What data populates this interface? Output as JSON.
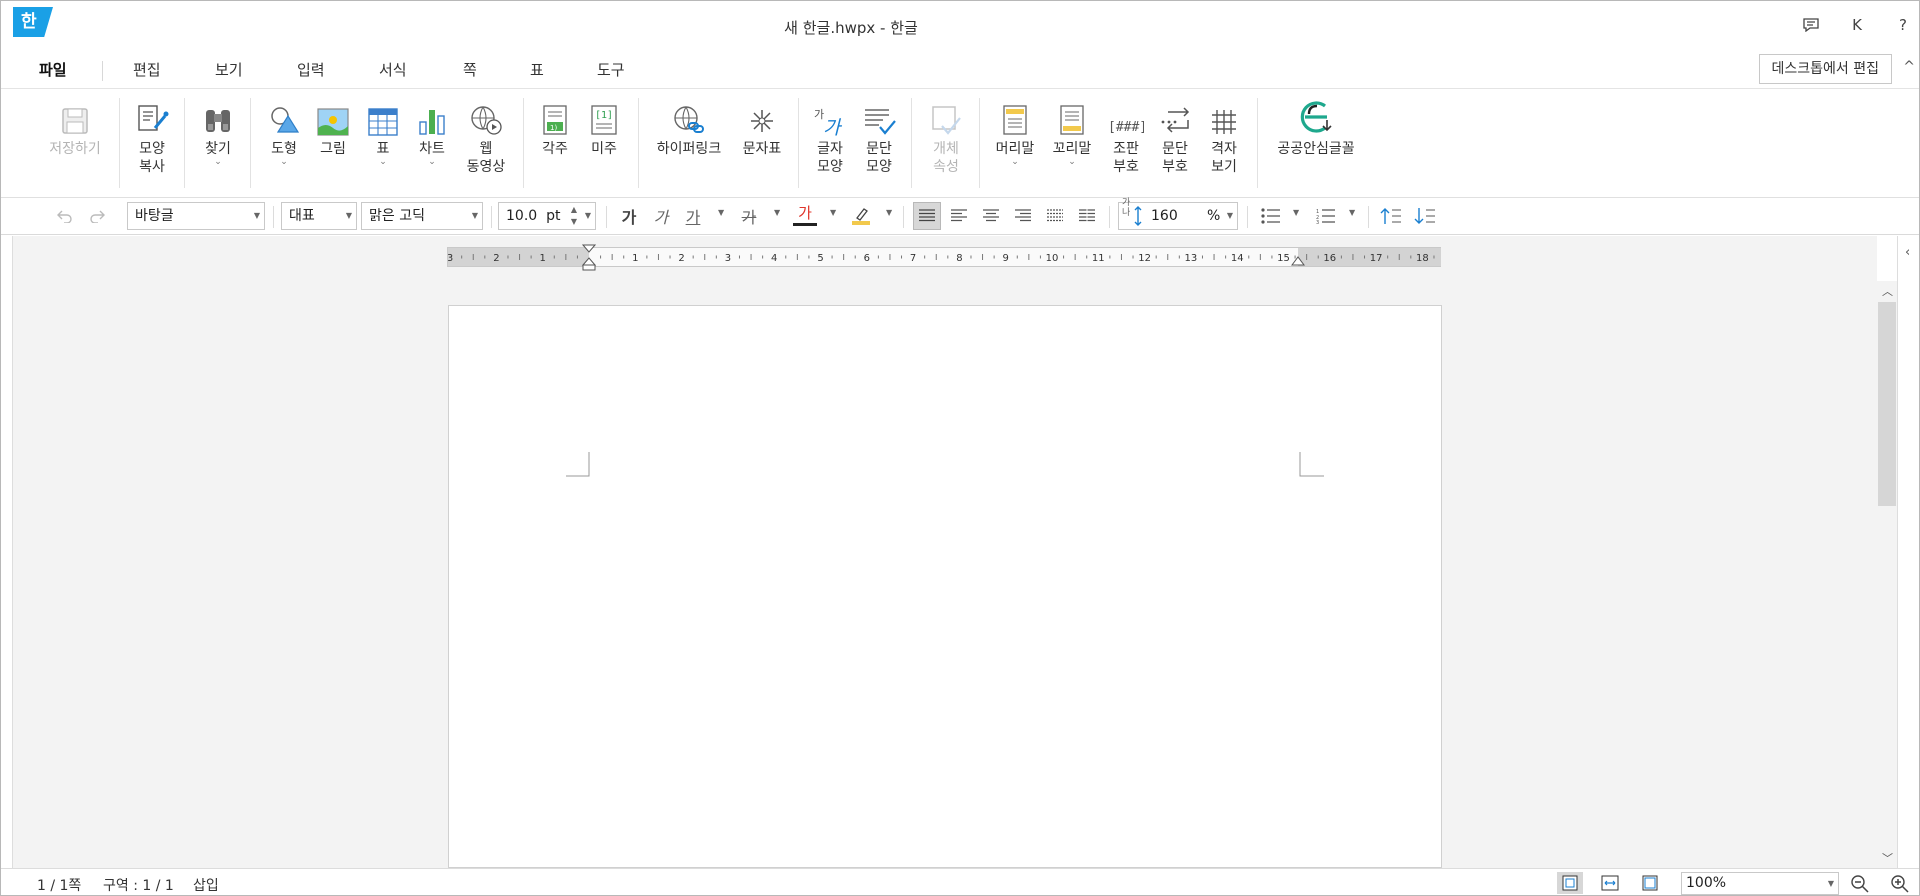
{
  "titlebar": {
    "logo_glyph": "한",
    "title": "새 한글.hwpx - 한글",
    "user_initial": "K",
    "help": "?"
  },
  "menu": {
    "tabs": [
      "파일",
      "편집",
      "보기",
      "입력",
      "서식",
      "쪽",
      "표",
      "도구"
    ],
    "active": "파일",
    "desktop_edit": "데스크톱에서 편집",
    "collapse": "^"
  },
  "ribbon": {
    "save": "저장하기",
    "format_copy": "모양\n복사",
    "find": "찾기",
    "shape": "도형",
    "picture": "그림",
    "table": "표",
    "chart": "차트",
    "web_video": "웹\n동영상",
    "footnote": "각주",
    "endnote": "미주",
    "hyperlink": "하이퍼링크",
    "char_map": "문자표",
    "char_shape": "글자\n모양",
    "para_shape": "문단\n모양",
    "object_props": "개체\n속성",
    "header": "머리말",
    "footer": "꼬리말",
    "layout_mark": "조판\n부호",
    "para_mark": "문단\n부호",
    "grid_view": "격자\n보기",
    "public_font": "공공안심글꼴",
    "dropdown_glyph": "⌄"
  },
  "format": {
    "style": "바탕글",
    "font_lang": "대표",
    "font_name": "맑은 고딕",
    "font_size": "10.0",
    "font_unit": "pt",
    "bold_glyph": "가",
    "italic_glyph": "가",
    "underline_glyph": "가",
    "strike_glyph": "가",
    "color_glyph": "가",
    "line_spacing_glyph": "가나",
    "line_spacing": "160",
    "line_spacing_unit": "%"
  },
  "ruler": {
    "labels": [
      "3",
      "2",
      "1",
      "1",
      "2",
      "3",
      "4",
      "5",
      "6",
      "7",
      "8",
      "9",
      "10",
      "11",
      "12",
      "13",
      "14",
      "15",
      "16",
      "17",
      "18"
    ]
  },
  "status": {
    "page": "1 / 1쪽",
    "section": "구역 : 1 / 1",
    "mode": "삽입",
    "zoom": "100%"
  },
  "colors": {
    "accent": "#1aa0e6",
    "highlight": "#f2c94c",
    "font_color": "#e0352b",
    "teal": "#1ea88d"
  }
}
